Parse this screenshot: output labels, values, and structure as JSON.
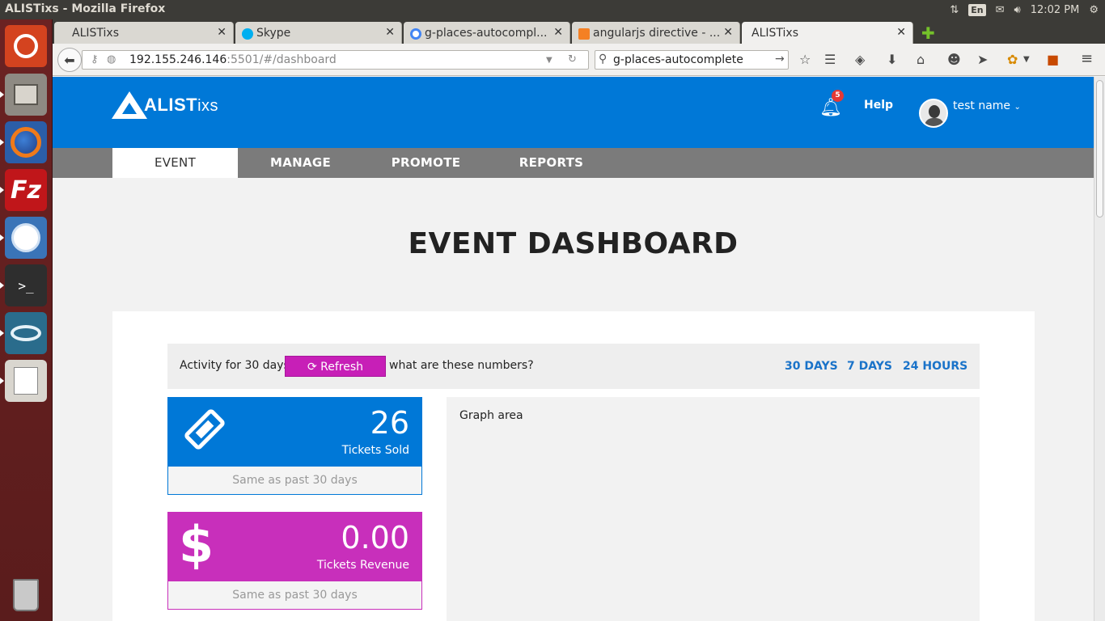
{
  "system": {
    "window_title": "ALISTixs - Mozilla Firefox",
    "lang": "En",
    "clock": "12:02 PM"
  },
  "browser": {
    "tabs": [
      {
        "label": "ALISTixs"
      },
      {
        "label": "Skype"
      },
      {
        "label": "g-places-autocompl..."
      },
      {
        "label": "angularjs directive - ..."
      },
      {
        "label": "ALISTixs"
      }
    ],
    "url_host": "192.155.246.146",
    "url_rest": ":5501/#/dashboard",
    "search_value": "g-places-autocomplete"
  },
  "app": {
    "logo_text": "ALIST",
    "logo_suffix": "ixs",
    "notification_count": "5",
    "help_label": "Help",
    "user_name": "test name",
    "nav": [
      "EVENT",
      "MANAGE",
      "PROMOTE",
      "REPORTS"
    ],
    "active_nav": "EVENT"
  },
  "dashboard": {
    "title": "EVENT DASHBOARD",
    "activity_label": "Activity for 30 days",
    "refresh_label": "Refresh",
    "help_link": "what are these numbers?",
    "ranges": [
      "30 DAYS",
      "7 DAYS",
      "24 HOURS"
    ],
    "cards": [
      {
        "value": "26",
        "label": "Tickets Sold",
        "footer": "Same as past 30 days",
        "color": "#0078d7"
      },
      {
        "value": "0.00",
        "label": "Tickets Revenue",
        "footer": "Same as past 30 days",
        "color": "#c82fbb"
      }
    ],
    "graph_label": "Graph area"
  },
  "colors": {
    "brand_blue": "#0078d7",
    "accent_magenta": "#c71fb7",
    "nav_gray": "#7b7b7b"
  }
}
